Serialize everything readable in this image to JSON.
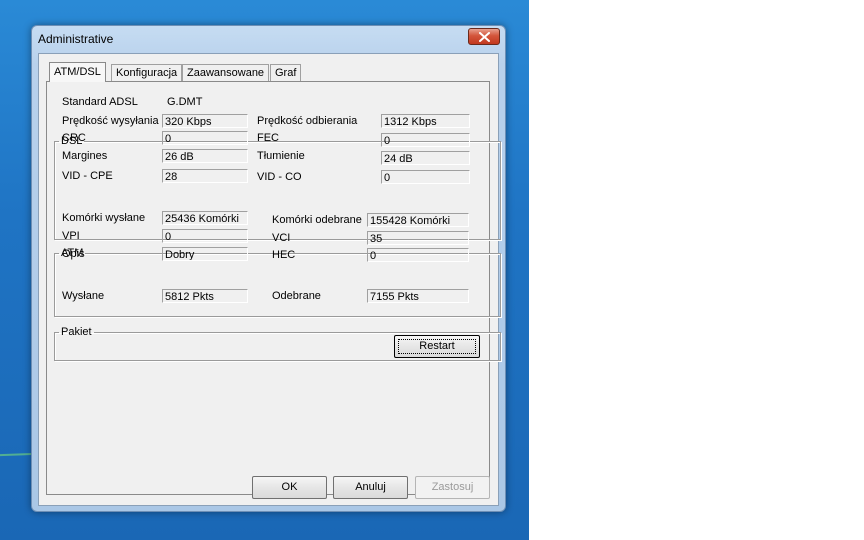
{
  "window": {
    "title": "Administrative"
  },
  "tabs": [
    {
      "label": "ATM/DSL",
      "active": true
    },
    {
      "label": "Konfiguracja",
      "active": false
    },
    {
      "label": "Zaawansowane",
      "active": false
    },
    {
      "label": "Graf",
      "active": false
    }
  ],
  "dsl": {
    "legend": "DSL",
    "standard_label": "Standard ADSL",
    "standard_value": "G.DMT",
    "upstream_label": "Prędkość wysyłania",
    "upstream_value": "320 Kbps",
    "downstream_label": "Prędkość odbierania",
    "downstream_value": "1312 Kbps",
    "crc_label": "CRC",
    "crc_value": "0",
    "fec_label": "FEC",
    "fec_value": "0",
    "margin_label": "Margines",
    "margin_value": "26 dB",
    "attenuation_label": "Tłumienie",
    "attenuation_value": "24 dB",
    "vidcpe_label": "VID - CPE",
    "vidcpe_value": "28",
    "vidco_label": "VID - CO",
    "vidco_value": "0"
  },
  "atm": {
    "legend": "ATM",
    "sent_label": "Komórki wysłane",
    "sent_value": "25436 Komórki",
    "recv_label": "Komórki odebrane",
    "recv_value": "155428 Komórki",
    "vpi_label": "VPI",
    "vpi_value": "0",
    "vci_label": "VCI",
    "vci_value": "35",
    "desc_label": "Opis",
    "desc_value": "Dobry",
    "hec_label": "HEC",
    "hec_value": "0"
  },
  "packet": {
    "legend": "Pakiet",
    "sent_label": "Wysłane",
    "sent_value": "5812 Pkts",
    "recv_label": "Odebrane",
    "recv_value": "7155 Pkts"
  },
  "buttons": {
    "restart": "Restart",
    "ok": "OK",
    "cancel": "Anuluj",
    "apply": "Zastosuj"
  },
  "icons": {
    "close": "close-icon"
  }
}
